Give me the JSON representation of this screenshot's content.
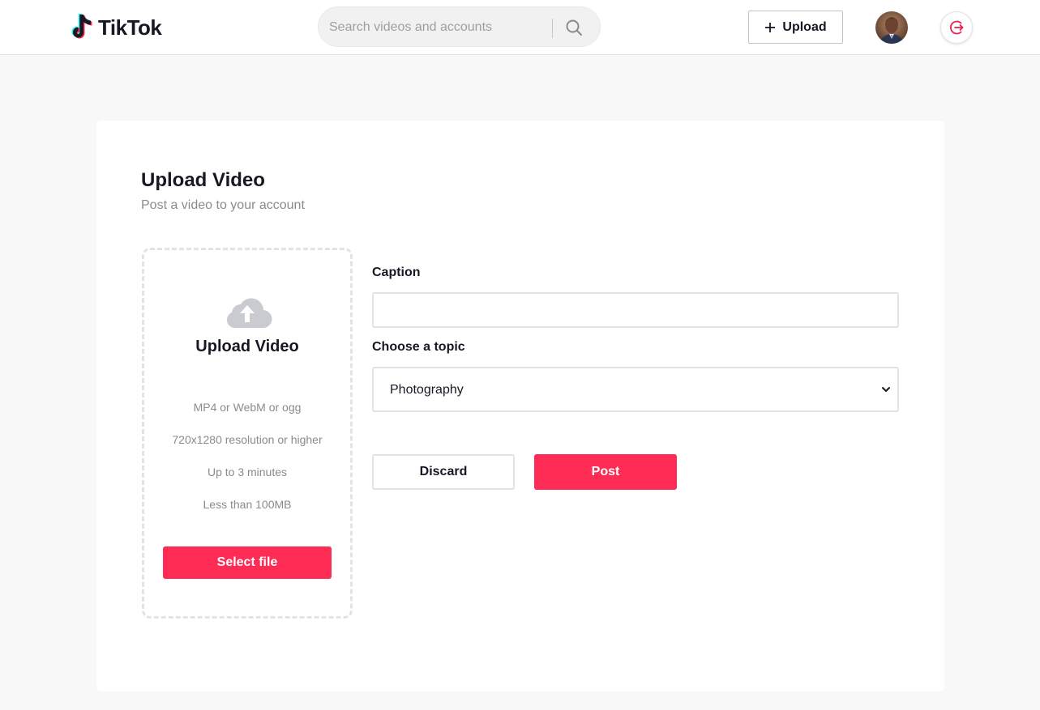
{
  "header": {
    "logo_text": "TikTok",
    "search": {
      "placeholder": "Search videos and accounts",
      "value": ""
    },
    "upload_label": "Upload"
  },
  "upload_page": {
    "title": "Upload Video",
    "subtitle": "Post a video to your account",
    "dropzone": {
      "title": "Upload Video",
      "requirements": [
        "MP4 or WebM or ogg",
        "720x1280 resolution or higher",
        "Up to 3 minutes",
        "Less than 100MB"
      ],
      "select_label": "Select file"
    },
    "caption": {
      "label": "Caption",
      "value": ""
    },
    "topic": {
      "label": "Choose a topic",
      "selected": "Photography"
    },
    "discard_label": "Discard",
    "post_label": "Post"
  },
  "colors": {
    "accent": "#fe2c55",
    "logout_icon": "#ee1d52",
    "page_background": "#f8f8f8",
    "text": "#161823",
    "muted_text": "#8a8b91",
    "border": "#e3e3e4"
  },
  "icons": {
    "logo": "tiktok-logo-icon",
    "search": "search-icon",
    "upload": "plus-icon",
    "logout": "logout-icon",
    "dropzone": "cloud-upload-icon",
    "select": "chevron-down-icon"
  }
}
